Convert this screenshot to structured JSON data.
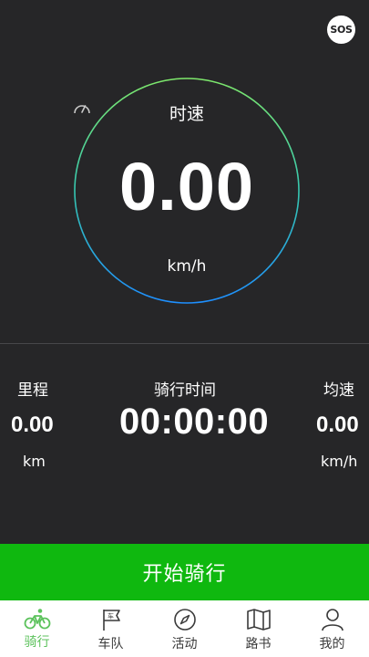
{
  "sos": {
    "label": "SOS"
  },
  "speed": {
    "label": "时速",
    "value": "0.00",
    "unit": "km/h"
  },
  "stats": {
    "distance": {
      "label": "里程",
      "value": "0.00",
      "unit": "km"
    },
    "ride_time": {
      "label": "骑行时间",
      "value": "00:00:00"
    },
    "avg_speed": {
      "label": "均速",
      "value": "0.00",
      "unit": "km/h"
    }
  },
  "start_button": {
    "label": "开始骑行"
  },
  "nav": {
    "items": [
      {
        "label": "骑行",
        "icon": "bicycle-icon",
        "active": true
      },
      {
        "label": "车队",
        "icon": "flag-icon",
        "active": false
      },
      {
        "label": "活动",
        "icon": "compass-icon",
        "active": false
      },
      {
        "label": "路书",
        "icon": "map-icon",
        "active": false
      },
      {
        "label": "我的",
        "icon": "person-icon",
        "active": false
      }
    ]
  },
  "colors": {
    "background": "#262628",
    "accent_green": "#0fb80f",
    "ring_top": "#7ee86b",
    "ring_bottom": "#1e8fff",
    "nav_active": "#5cc25c"
  }
}
